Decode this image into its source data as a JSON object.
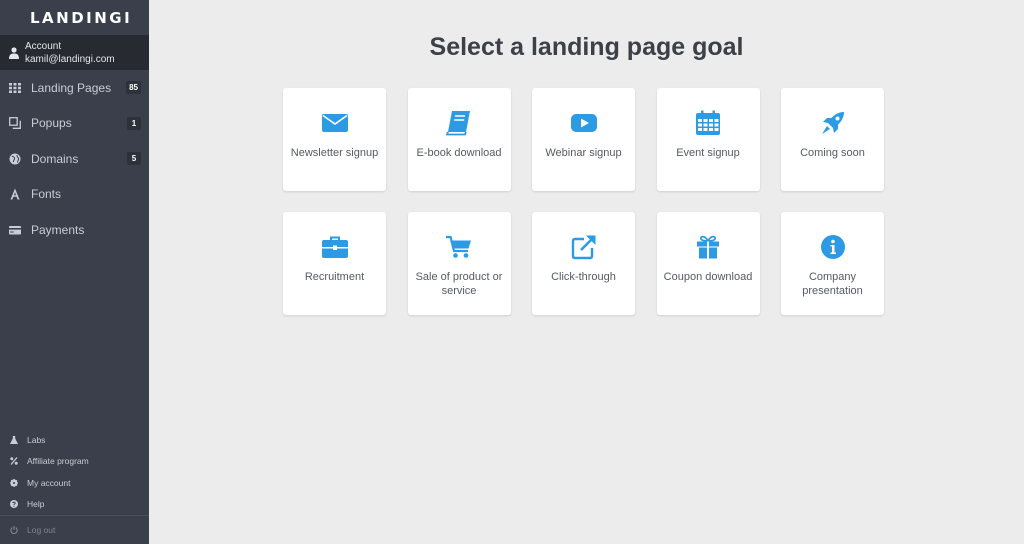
{
  "brand": {
    "logo_text": "LANDINGI"
  },
  "account": {
    "label": "Account",
    "email": "kamil@landingi.com"
  },
  "sidebar": {
    "items": [
      {
        "label": "Landing Pages",
        "badge": "85",
        "icon": "grid-icon"
      },
      {
        "label": "Popups",
        "badge": "1",
        "icon": "popup-icon"
      },
      {
        "label": "Domains",
        "badge": "5",
        "icon": "globe-icon"
      },
      {
        "label": "Fonts",
        "badge": "",
        "icon": "font-icon"
      },
      {
        "label": "Payments",
        "badge": "",
        "icon": "credit-card-icon"
      }
    ],
    "bottom": [
      {
        "label": "Labs",
        "icon": "flask-icon"
      },
      {
        "label": "Affiliate program",
        "icon": "percent-icon"
      },
      {
        "label": "My account",
        "icon": "gear-icon"
      },
      {
        "label": "Help",
        "icon": "question-icon"
      }
    ],
    "logout": "Log out"
  },
  "main": {
    "title": "Select a landing page goal",
    "goals": [
      {
        "label": "Newsletter signup",
        "icon": "envelope-icon"
      },
      {
        "label": "E-book download",
        "icon": "book-icon"
      },
      {
        "label": "Webinar signup",
        "icon": "play-icon"
      },
      {
        "label": "Event signup",
        "icon": "calendar-icon"
      },
      {
        "label": "Coming soon",
        "icon": "rocket-icon"
      },
      {
        "label": "Recruitment",
        "icon": "briefcase-icon"
      },
      {
        "label": "Sale of product or service",
        "icon": "cart-icon"
      },
      {
        "label": "Click-through",
        "icon": "external-link-icon"
      },
      {
        "label": "Coupon download",
        "icon": "gift-icon"
      },
      {
        "label": "Company presentation",
        "icon": "info-icon"
      }
    ]
  },
  "colors": {
    "accent": "#2d9be3",
    "sidebar_bg": "#3a3f4b",
    "account_bg": "#272a31",
    "page_bg": "#ececec"
  }
}
